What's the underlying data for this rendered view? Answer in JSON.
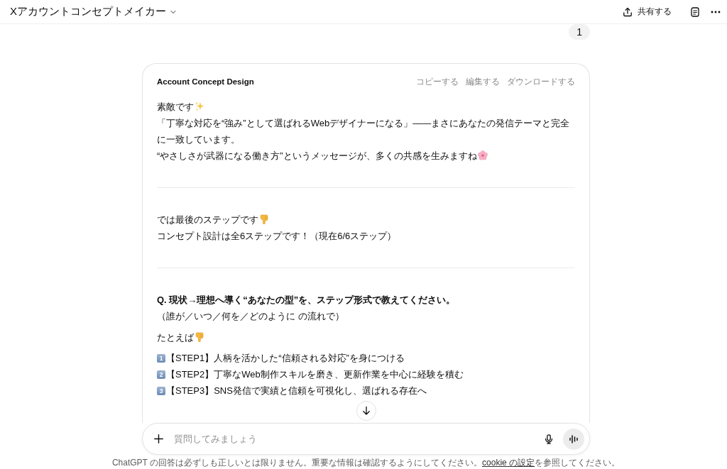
{
  "header": {
    "title": "Xアカウントコンセプトメイカー",
    "share_label": "共有する"
  },
  "user_message": {
    "text": "1"
  },
  "canvas": {
    "title": "Account Concept Design",
    "actions": [
      "コピーする",
      "編集する",
      "ダウンロードする"
    ],
    "blocks": [
      {
        "kind": "lines",
        "lines": [
          {
            "kind": "sparkle",
            "text": "素敵です"
          },
          {
            "kind": "plain",
            "text": "「丁寧な対応を“強み”として選ばれるWebデザイナーになる」——まさにあなたの発信テーマと完全に一致しています。"
          },
          {
            "kind": "flower",
            "text": "“やさしさが武器になる働き方”というメッセージが、多くの共感を生みますね"
          }
        ]
      },
      {
        "kind": "divider"
      },
      {
        "kind": "lines",
        "lines": [
          {
            "kind": "pointing-down",
            "text": "では最後のステップです"
          },
          {
            "kind": "plain",
            "text": "コンセプト設計は全6ステップです！（現在6/6ステップ）"
          }
        ]
      },
      {
        "kind": "divider"
      },
      {
        "kind": "question",
        "text": "Q. 現状→理想へ導く“あなたの型”を、ステップ形式で教えてください。",
        "note": "（誰が／いつ／何を／どのように の流れで）"
      },
      {
        "kind": "lines",
        "lines": [
          {
            "kind": "pointing-down",
            "text": "たとえば"
          }
        ]
      },
      {
        "kind": "steps",
        "items": [
          {
            "number": "1",
            "text": "【STEP1】人柄を活かした“信頼される対応”を身につける"
          },
          {
            "number": "2",
            "text": "【STEP2】丁寧なWeb制作スキルを磨き、更新作業を中心に経験を積む"
          },
          {
            "number": "3",
            "text": "【STEP3】SNS発信で実績と信頼を可視化し、選ばれる存在へ"
          }
        ]
      }
    ]
  },
  "composer": {
    "placeholder": "質問してみましょう"
  },
  "footer": {
    "parts": [
      {
        "kind": "text",
        "text": "ChatGPT の回答は必ずしも正しいとは限りません。重要な情報は確認するようにしてください。"
      },
      {
        "kind": "link",
        "text": "cookie の設定"
      },
      {
        "kind": "text",
        "text": "を参照してください。"
      }
    ]
  }
}
